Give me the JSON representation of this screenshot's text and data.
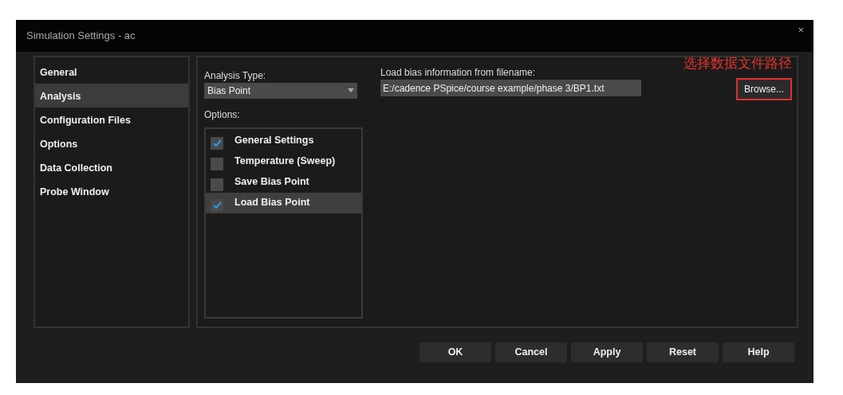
{
  "window": {
    "title": "Simulation Settings - ac",
    "close": "×"
  },
  "sidebar": {
    "items": [
      {
        "label": "General",
        "selected": false
      },
      {
        "label": "Analysis",
        "selected": true
      },
      {
        "label": "Configuration Files",
        "selected": false
      },
      {
        "label": "Options",
        "selected": false
      },
      {
        "label": "Data Collection",
        "selected": false
      },
      {
        "label": "Probe Window",
        "selected": false
      }
    ]
  },
  "analysis_type": {
    "label": "Analysis Type:",
    "value": "Bias Point"
  },
  "options": {
    "label": "Options:",
    "items": [
      {
        "label": "General Settings",
        "checked": true,
        "selected": false
      },
      {
        "label": "Temperature (Sweep)",
        "checked": false,
        "selected": false
      },
      {
        "label": "Save Bias Point",
        "checked": false,
        "selected": false
      },
      {
        "label": "Load Bias Point",
        "checked": true,
        "selected": true
      }
    ]
  },
  "load_bias": {
    "label": "Load bias information from filename:",
    "value": "E:/cadence PSpice/course example/phase 3/BP1.txt",
    "button": "Browse...",
    "highlighted": true
  },
  "annotation": "选择数据文件路径",
  "buttons": [
    "OK",
    "Cancel",
    "Apply",
    "Reset",
    "Help"
  ]
}
